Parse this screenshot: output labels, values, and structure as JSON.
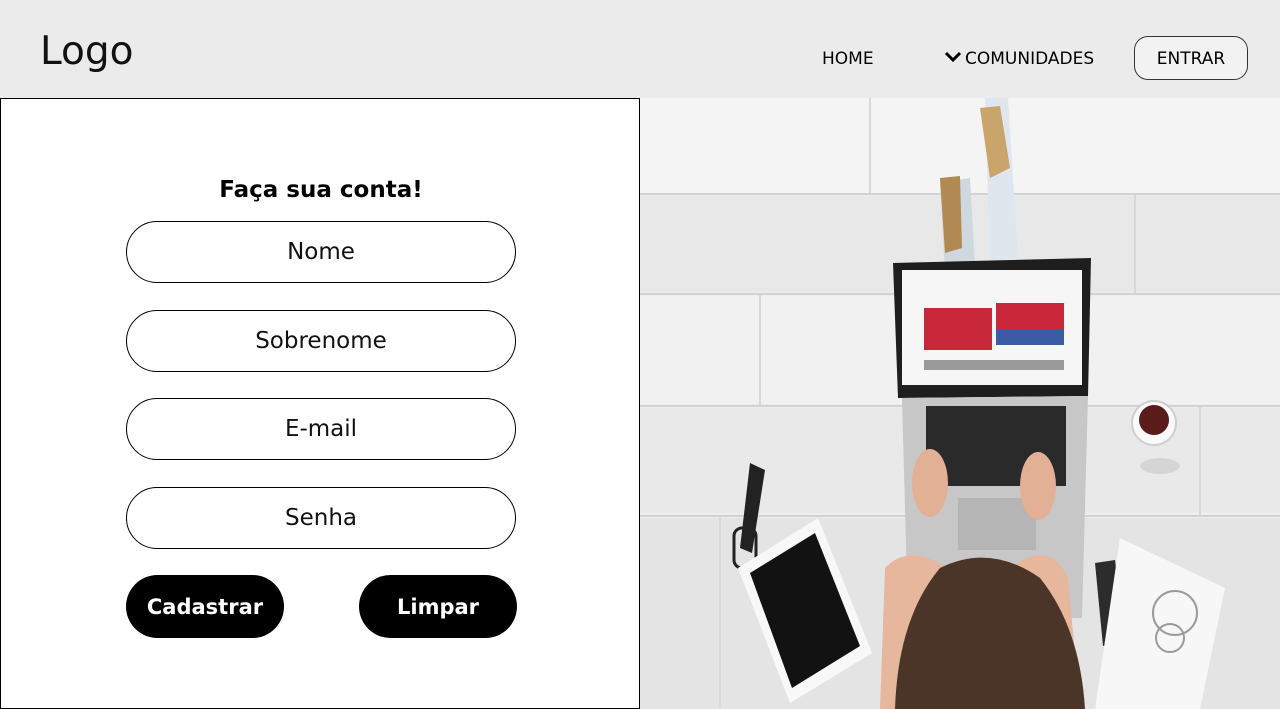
{
  "header": {
    "logo_text": "Logo",
    "nav": {
      "home": "HOME",
      "comunidades": "COMUNIDADES",
      "entrar": "ENTRAR"
    }
  },
  "form": {
    "title": "Faça sua conta!",
    "fields": {
      "nome": "Nome",
      "sobrenome": "Sobrenome",
      "email": "E-mail",
      "senha": "Senha"
    },
    "buttons": {
      "cadastrar": "Cadastrar",
      "limpar": "Limpar"
    }
  },
  "icons": {
    "nav_dropdown": "chevron-down-icon"
  },
  "colors": {
    "header_bg": "#ebebeb",
    "button_bg": "#000000",
    "button_text": "#ffffff"
  }
}
